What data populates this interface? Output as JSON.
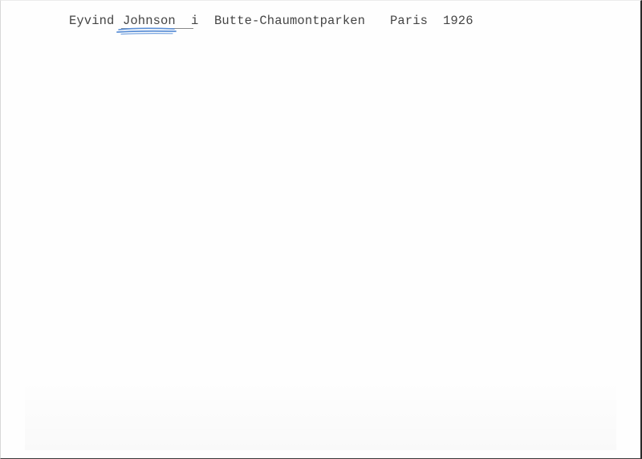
{
  "caption": {
    "first_name": "Eyvind",
    "last_name": "Johnson",
    "preposition": "i",
    "place": "Butte-Chaumontparken",
    "city": "Paris",
    "year": "1926"
  },
  "colors": {
    "paper": "#fefefe",
    "typewriter_ink": "#454545",
    "pen_underline": "#5b8fd6"
  }
}
